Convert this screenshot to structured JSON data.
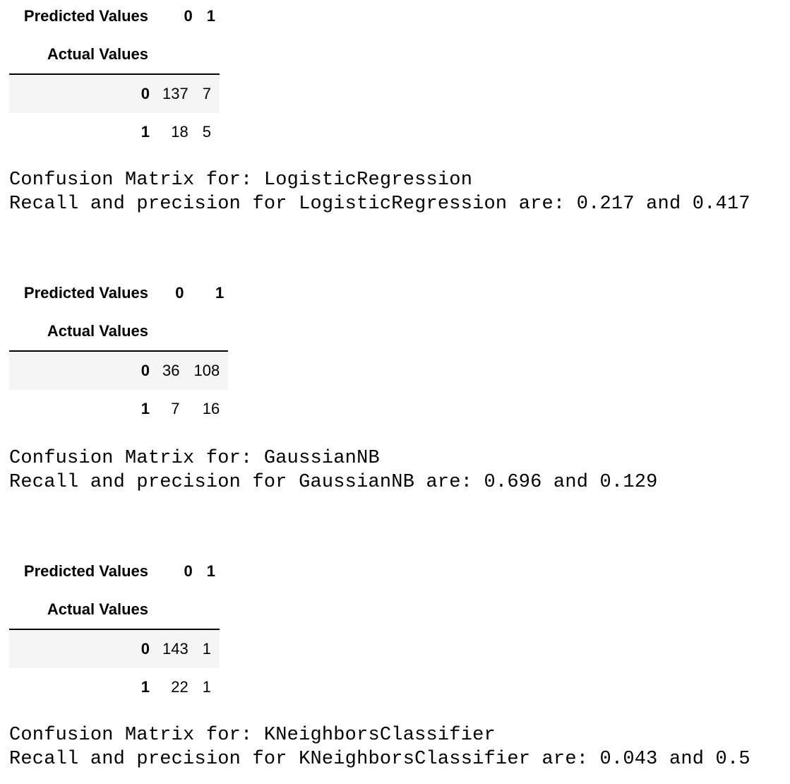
{
  "outputs": [
    {
      "table": {
        "columns_name": "Predicted Values",
        "index_name": "Actual Values",
        "columns": [
          "0",
          "1"
        ],
        "rows": [
          {
            "label": "0",
            "values": [
              "137",
              "7"
            ]
          },
          {
            "label": "1",
            "values": [
              "18",
              "5"
            ]
          }
        ]
      },
      "title_line": "Confusion Matrix for: LogisticRegression",
      "metrics_line": "Recall and precision for LogisticRegression are: 0.217 and 0.417"
    },
    {
      "table": {
        "columns_name": "Predicted Values",
        "index_name": "Actual Values",
        "columns": [
          "0",
          "1"
        ],
        "rows": [
          {
            "label": "0",
            "values": [
              "36",
              "108"
            ]
          },
          {
            "label": "1",
            "values": [
              "7",
              "16"
            ]
          }
        ]
      },
      "title_line": "Confusion Matrix for: GaussianNB",
      "metrics_line": "Recall and precision for GaussianNB are: 0.696 and 0.129"
    },
    {
      "table": {
        "columns_name": "Predicted Values",
        "index_name": "Actual Values",
        "columns": [
          "0",
          "1"
        ],
        "rows": [
          {
            "label": "0",
            "values": [
              "143",
              "1"
            ]
          },
          {
            "label": "1",
            "values": [
              "22",
              "1"
            ]
          }
        ]
      },
      "title_line": "Confusion Matrix for: KNeighborsClassifier",
      "metrics_line": "Recall and precision for KNeighborsClassifier are: 0.043 and 0.5"
    }
  ]
}
